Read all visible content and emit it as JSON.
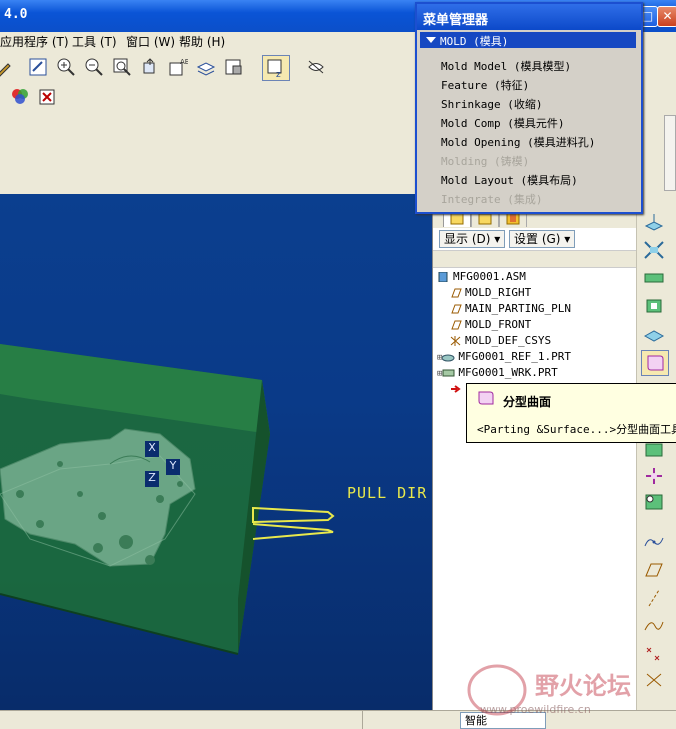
{
  "window": {
    "title": "4.0"
  },
  "menubar": {
    "items": [
      "应用程序 (T)",
      "工具 (T)",
      "窗口 (W)",
      "帮助 (H)"
    ]
  },
  "menu_manager": {
    "title": "菜单管理器",
    "header": "MOLD (模具)",
    "items": [
      {
        "label": "Mold Model (模具模型)",
        "enabled": true
      },
      {
        "label": "Feature (特征)",
        "enabled": true
      },
      {
        "label": "Shrinkage (收缩)",
        "enabled": true
      },
      {
        "label": "Mold Comp (模具元件)",
        "enabled": true
      },
      {
        "label": "Mold Opening (模具进料孔)",
        "enabled": true
      },
      {
        "label": "Molding (铸模)",
        "enabled": false
      },
      {
        "label": "Mold Layout (模具布局)",
        "enabled": true
      },
      {
        "label": "Integrate (集成)",
        "enabled": false
      }
    ]
  },
  "model_tree": {
    "show_label": "显示 (D) ▾",
    "settings_label": "设置 (G) ▾",
    "items": [
      {
        "label": "MFG0001.ASM",
        "icon": "assembly-icon"
      },
      {
        "label": "MOLD_RIGHT",
        "icon": "datum-plane-icon"
      },
      {
        "label": "MAIN_PARTING_PLN",
        "icon": "datum-plane-icon"
      },
      {
        "label": "MOLD_FRONT",
        "icon": "datum-plane-icon"
      },
      {
        "label": "MOLD_DEF_CSYS",
        "icon": "csys-icon"
      },
      {
        "label": "MFG0001_REF_1.PRT",
        "icon": "part-icon"
      },
      {
        "label": "MFG0001_WRK.PRT",
        "icon": "workpiece-icon"
      }
    ]
  },
  "tooltip": {
    "title": "分型曲面",
    "description": "<Parting &Surface...>分型曲面工具"
  },
  "viewport": {
    "pull_direction": "PULL DIR",
    "csys_labels": {
      "x": "X",
      "y": "Y",
      "z": "Z"
    }
  },
  "status": {
    "filter": "智能"
  },
  "watermark": {
    "text": "野火论坛",
    "url": "www.proewildfire.cn"
  }
}
